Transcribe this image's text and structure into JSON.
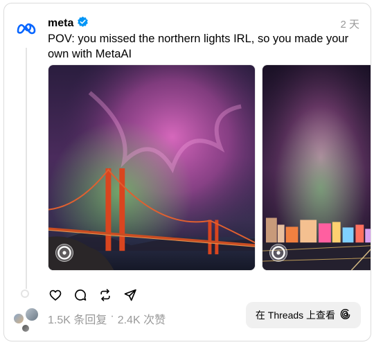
{
  "post": {
    "author": "meta",
    "verified": true,
    "timestamp": "2 天",
    "text": "POV: you missed the northern lights IRL, so you made your own with MetaAI",
    "media": [
      {
        "icon": "golden-gate-aurora-image"
      },
      {
        "icon": "city-skyline-aurora-image"
      }
    ]
  },
  "actions": {
    "like": "heart-icon",
    "reply": "comment-icon",
    "repost": "repost-icon",
    "share": "send-icon"
  },
  "stats": {
    "replies": "1.5K 条回复",
    "separator": "·",
    "likes": "2.4K 次赞"
  },
  "threads_button": {
    "label": "在 Threads 上查看"
  },
  "colors": {
    "meta_blue": "#0866ff",
    "verified_blue": "#0095f6",
    "muted_text": "#999999",
    "button_bg": "#f0f0f0"
  }
}
